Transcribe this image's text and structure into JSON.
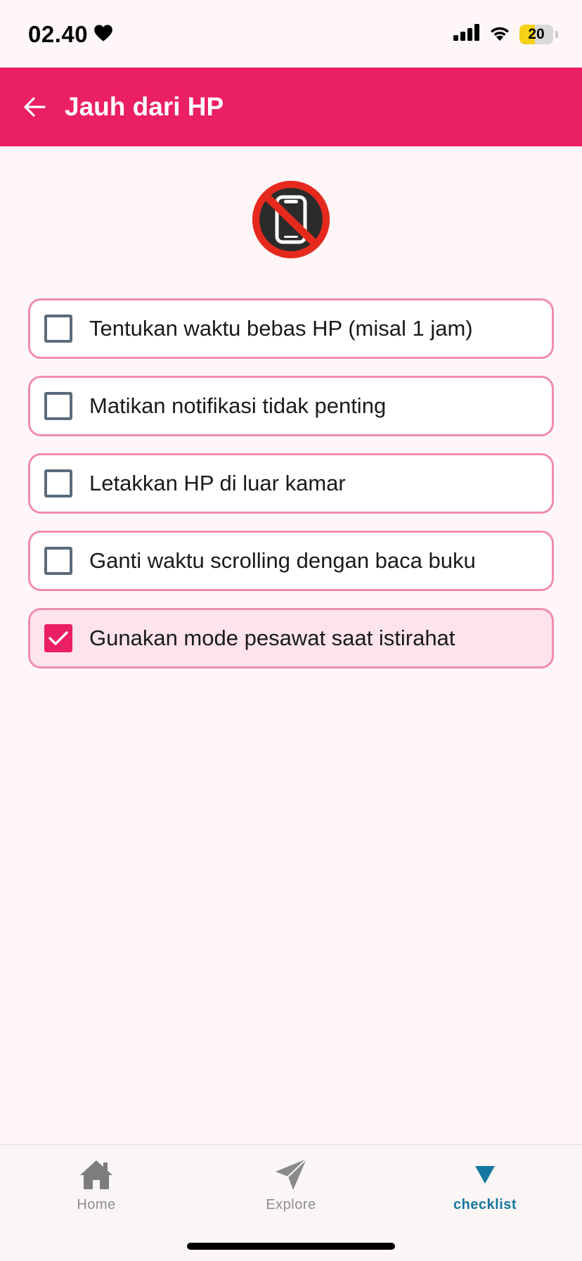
{
  "status_bar": {
    "time": "02.40",
    "battery": "20",
    "heart_icon": "heart-icon",
    "signal_icon": "cellular-signal-icon",
    "wifi_icon": "wifi-icon"
  },
  "app_bar": {
    "title": "Jauh dari HP",
    "back_icon": "arrow-left-icon",
    "background_color": "#eb1f63"
  },
  "hero": {
    "icon": "no-mobile-phones-icon"
  },
  "checklist": {
    "items": [
      {
        "label": "Tentukan waktu bebas HP (misal 1 jam)",
        "checked": false
      },
      {
        "label": "Matikan notifikasi tidak penting",
        "checked": false
      },
      {
        "label": "Letakkan HP di luar kamar",
        "checked": false
      },
      {
        "label": "Ganti waktu scrolling dengan baca buku",
        "checked": false
      },
      {
        "label": "Gunakan mode pesawat saat istirahat",
        "checked": true
      }
    ],
    "accent_color": "#eb1f63",
    "border_color": "#f08cb1"
  },
  "bottom_nav": {
    "items": [
      {
        "label": "Home",
        "icon": "home-icon",
        "active": false
      },
      {
        "label": "Explore",
        "icon": "paper-plane-icon",
        "active": false
      },
      {
        "label": "checklist",
        "icon": "triangle-down-icon",
        "active": true
      }
    ],
    "active_color": "#1577a0",
    "inactive_color": "#8e8e8e"
  }
}
